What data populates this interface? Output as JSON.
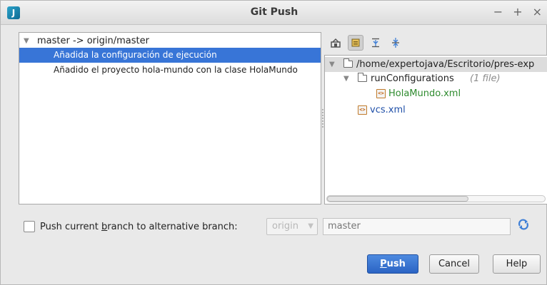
{
  "window": {
    "title": "Git Push",
    "minimize": "−",
    "maximize": "+",
    "close": "×"
  },
  "commits": {
    "branch_label": "master -> origin/master",
    "items": [
      {
        "label": "Añadida la configuración de ejecución",
        "selected": true
      },
      {
        "label": "Añadido el proyecto hola-mundo con la clase HolaMundo",
        "selected": false
      }
    ]
  },
  "toolbar": {
    "icons": [
      "show-modules-icon",
      "group-by-directory-icon",
      "expand-all-icon",
      "collapse-all-icon"
    ]
  },
  "tree": {
    "root": "/home/expertojava/Escritorio/pres-exp",
    "folder": "runConfigurations",
    "folder_count": "(1 file)",
    "file1": "HolaMundo.xml",
    "file2": "vcs.xml"
  },
  "options": {
    "checkbox_prefix": "Push current ",
    "checkbox_mnemonic": "b",
    "checkbox_suffix": "ranch to alternative branch:",
    "remote": "origin",
    "branch": "master"
  },
  "buttons": {
    "push_mnemonic": "P",
    "push_rest": "ush",
    "cancel": "Cancel",
    "help": "Help"
  }
}
